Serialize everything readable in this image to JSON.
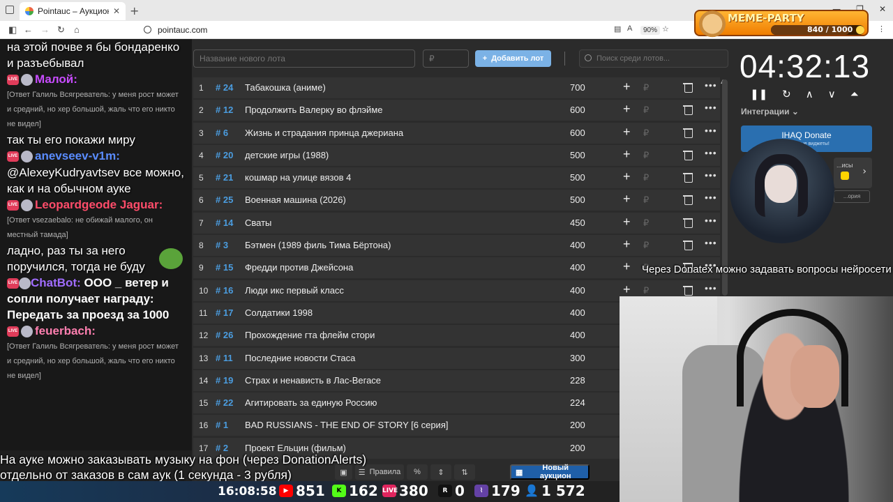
{
  "browser": {
    "tab_title": "Pointauc – Аукционы, лотереи",
    "url": "pointauc.com",
    "zoom": "90%"
  },
  "meme_party": {
    "name": "MEME-PARTY",
    "count": "840 / 1000",
    "progress": 0.84
  },
  "chat": [
    {
      "type": "text",
      "text": "на этой почве я бы бондаренко и разъебывал"
    },
    {
      "type": "user",
      "name": "Малой:",
      "color": "#c84cff"
    },
    {
      "type": "reply",
      "text": "[Ответ Галиль Всягреватель: у меня рост может и средний, но хер большой, жаль что его никто не видел]"
    },
    {
      "type": "text",
      "text": "так ты его покажи миру"
    },
    {
      "type": "user",
      "name": "anevseev-v1m:",
      "color": "#5a8cff"
    },
    {
      "type": "text",
      "text": "@AlexeyKudryavtsev все можно, как и на обычном ауке"
    },
    {
      "type": "user",
      "name": "Leopardgeode Jaguar:",
      "color": "#ff4c6a"
    },
    {
      "type": "reply",
      "text": "[Ответ vsezaebalo: не обижай малого, он местный тамада]"
    },
    {
      "type": "text",
      "text": "ладно, раз ты за него поручился, тогда не буду"
    },
    {
      "type": "user",
      "name": "ChatBot:",
      "color": "#a06cff",
      "inline": "ООО _ ветер и сопли получает награду: Передать за проезд за 1000"
    },
    {
      "type": "user",
      "name": "feuerbach:",
      "color": "#ff7fb0"
    },
    {
      "type": "reply",
      "text": "[Ответ Галиль Всягреватель: у меня рост может и средний, но хер большой, жаль что его никто не видел]"
    }
  ],
  "form": {
    "lot_name_placeholder": "Название нового лота",
    "amount_placeholder": "₽",
    "add_button": "Добавить лот",
    "search_placeholder": "Поиск среди лотов..."
  },
  "lots": [
    {
      "idx": "1",
      "id": "# 24",
      "name": "Табакошка (аниме)",
      "value": "700"
    },
    {
      "idx": "2",
      "id": "# 12",
      "name": "Продолжить Валерку во флэйме",
      "value": "600"
    },
    {
      "idx": "3",
      "id": "# 6",
      "name": "Жизнь и страдания принца джериана",
      "value": "600"
    },
    {
      "idx": "4",
      "id": "# 20",
      "name": "детские игры (1988)",
      "value": "500"
    },
    {
      "idx": "5",
      "id": "# 21",
      "name": "кошмар на улице вязов 4",
      "value": "500"
    },
    {
      "idx": "6",
      "id": "# 25",
      "name": "Военная машина (2026)",
      "value": "500"
    },
    {
      "idx": "7",
      "id": "# 14",
      "name": "Сваты",
      "value": "450"
    },
    {
      "idx": "8",
      "id": "# 3",
      "name": "Бэтмен (1989 филь Тима Бёртона)",
      "value": "400"
    },
    {
      "idx": "9",
      "id": "# 15",
      "name": "Фредди против Джейсона",
      "value": "400"
    },
    {
      "idx": "10",
      "id": "# 16",
      "name": "Люди икс первый класс",
      "value": "400"
    },
    {
      "idx": "11",
      "id": "# 17",
      "name": "Солдатики 1998",
      "value": "400"
    },
    {
      "idx": "12",
      "id": "# 26",
      "name": "Прохождение гта флейм стори",
      "value": "400"
    },
    {
      "idx": "13",
      "id": "# 11",
      "name": "Последние новости Стаса",
      "value": "300"
    },
    {
      "idx": "14",
      "id": "# 19",
      "name": "Страх и ненависть в Лас-Вегасе",
      "value": "228"
    },
    {
      "idx": "15",
      "id": "# 22",
      "name": "Агитировать за единую Россию",
      "value": "224"
    },
    {
      "idx": "16",
      "id": "# 1",
      "name": "BAD RUSSIANS - THE END OF STORY [6 серия]",
      "value": "200"
    },
    {
      "idx": "17",
      "id": "# 2",
      "name": "Проект Ельцин (фильм)",
      "value": "200"
    }
  ],
  "currency": "₽",
  "bottom": {
    "rules": "Правила",
    "percent": "%",
    "new_auction": "Новый аукцион"
  },
  "panel": {
    "timer": "04:32:13",
    "integrations": "Интеграции",
    "donate_title": "IHAQ Donate",
    "donate_sub": "...кальные виджеты!",
    "card_text": "...исы",
    "history": "...ория"
  },
  "captions": {
    "donatex": "Через Donatex можно задавать вопросы нейросети",
    "notice_1": "На ауке можно заказывать музыку на фон (через DonationAlerts)",
    "notice_2": "отдельно от заказов в сам аук (1 секунда - 3 рубля)"
  },
  "stats": {
    "time": "16:08:58",
    "youtube": "851",
    "kick": "162",
    "vkplay": "380",
    "rutube": "0",
    "twitch": "179",
    "total": "1 572"
  }
}
